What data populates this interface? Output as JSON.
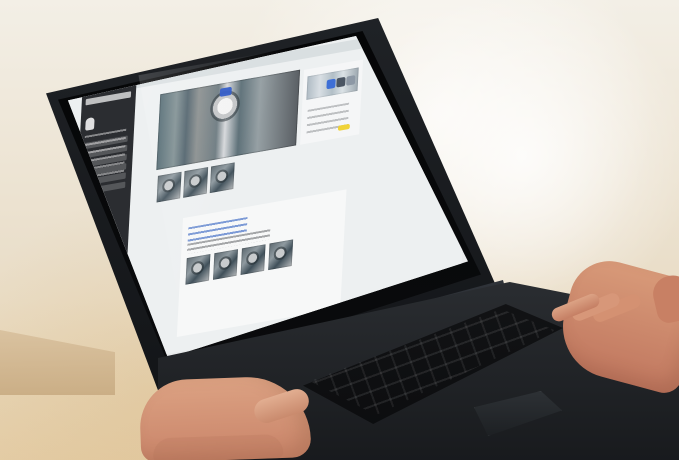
{
  "scene": {
    "type": "photo",
    "subject": "laptop-on-desk",
    "screen_layout": "web-app-dashboard",
    "accent_color": "#2b56c7",
    "highlight_color": "#f0d338"
  }
}
